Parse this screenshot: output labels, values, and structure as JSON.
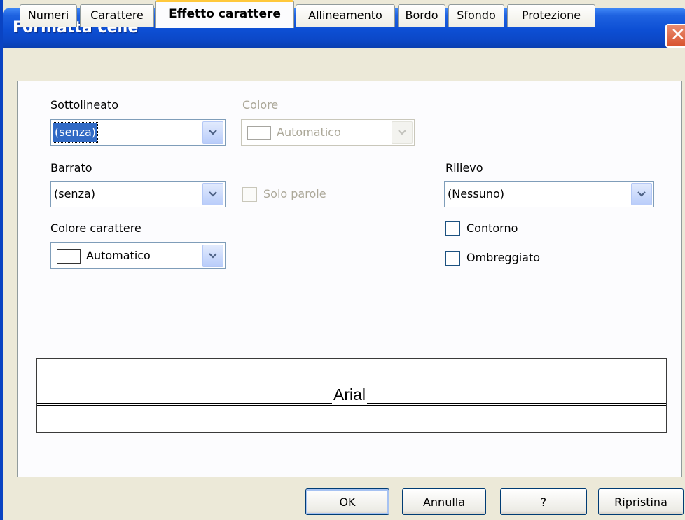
{
  "window": {
    "title": "Formatta celle",
    "close_glyph": "✕"
  },
  "tabs": [
    {
      "label": "Numeri",
      "active": false
    },
    {
      "label": "Carattere",
      "active": false
    },
    {
      "label": "Effetto carattere",
      "active": true
    },
    {
      "label": "Allineamento",
      "active": false
    },
    {
      "label": "Bordo",
      "active": false
    },
    {
      "label": "Sfondo",
      "active": false
    },
    {
      "label": "Protezione",
      "active": false
    }
  ],
  "fields": {
    "sottolineato": {
      "label": "Sottolineato",
      "value": "(senza)"
    },
    "colore": {
      "label": "Colore",
      "value": "Automatico",
      "disabled": true
    },
    "barrato": {
      "label": "Barrato",
      "value": "(senza)"
    },
    "solo_parole": {
      "label": "Solo parole",
      "checked": false,
      "disabled": true
    },
    "colore_carattere": {
      "label": "Colore carattere",
      "value": "Automatico"
    },
    "rilievo": {
      "label": "Rilievo",
      "value": "(Nessuno)"
    },
    "contorno": {
      "label": "Contorno",
      "checked": false
    },
    "ombreggiato": {
      "label": "Ombreggiato",
      "checked": false
    }
  },
  "preview": {
    "text": "Arial"
  },
  "buttons": {
    "ok": "OK",
    "annulla": "Annulla",
    "help": "?",
    "ripristina": "Ripristina"
  },
  "colors": {
    "titlebar": "#0d4fd4",
    "dialog_bg": "#ece9d8",
    "active_tab_accent": "#ffc83c",
    "selection": "#316ac5"
  }
}
